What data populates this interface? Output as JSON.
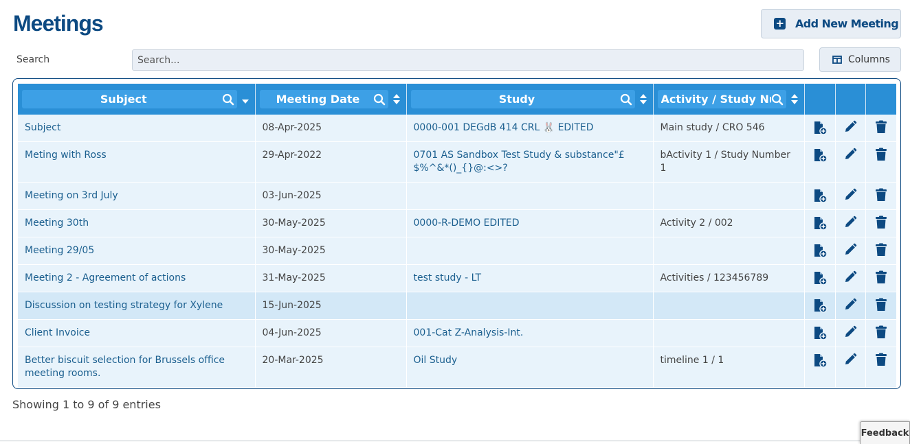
{
  "header": {
    "title": "Meetings",
    "add_label": "Add New Meeting"
  },
  "search": {
    "label": "Search",
    "placeholder": "Search...",
    "value": ""
  },
  "columns_label": "Columns",
  "table": {
    "headers": [
      "Subject",
      "Meeting Date",
      "Study",
      "Activity / Study Nur"
    ],
    "rows": [
      {
        "subject": "Subject",
        "date": "08-Apr-2025",
        "study": "0000-001 DEGdB 414 CRL 🐰 EDITED",
        "activity": "Main study / CRO 546"
      },
      {
        "subject": "Meting with Ross",
        "date": "29-Apr-2022",
        "study": "0701 AS Sandbox Test Study & substance\"£$%^&*()_{}@:<>?",
        "activity": "bActivity 1 / Study Number 1"
      },
      {
        "subject": "Meeting on 3rd July",
        "date": "03-Jun-2025",
        "study": "",
        "activity": ""
      },
      {
        "subject": "Meeting 30th",
        "date": "30-May-2025",
        "study": "0000-R-DEMO EDITED",
        "activity": "Activity 2 / 002"
      },
      {
        "subject": "Meeting 29/05",
        "date": "30-May-2025",
        "study": "",
        "activity": ""
      },
      {
        "subject": "Meeting 2 - Agreement of actions",
        "date": "31-May-2025",
        "study": "test study - LT",
        "activity": "Activities / 123456789"
      },
      {
        "subject": "Discussion on testing strategy for Xylene",
        "date": "15-Jun-2025",
        "study": "",
        "activity": ""
      },
      {
        "subject": "Client Invoice",
        "date": "04-Jun-2025",
        "study": "001-Cat Z-Analysis-Int.",
        "activity": ""
      },
      {
        "subject": "Better biscuit selection for Brussels office meeting rooms.",
        "date": "20-Mar-2025",
        "study": "Oil Study",
        "activity": "timeline 1 / 1"
      }
    ]
  },
  "footer": {
    "info": "Showing 1 to 9 of 9 entries",
    "feedback": "Feedback"
  },
  "colors": {
    "primary": "#0d4a82",
    "header_bg": "#2a8fd6",
    "row_bg": "#e8f3fb",
    "row_highlight": "#d3e8f7",
    "link": "#1b5f8f"
  },
  "icons": {
    "row_actions": [
      "file-add-icon",
      "pencil-icon",
      "trash-icon"
    ]
  }
}
